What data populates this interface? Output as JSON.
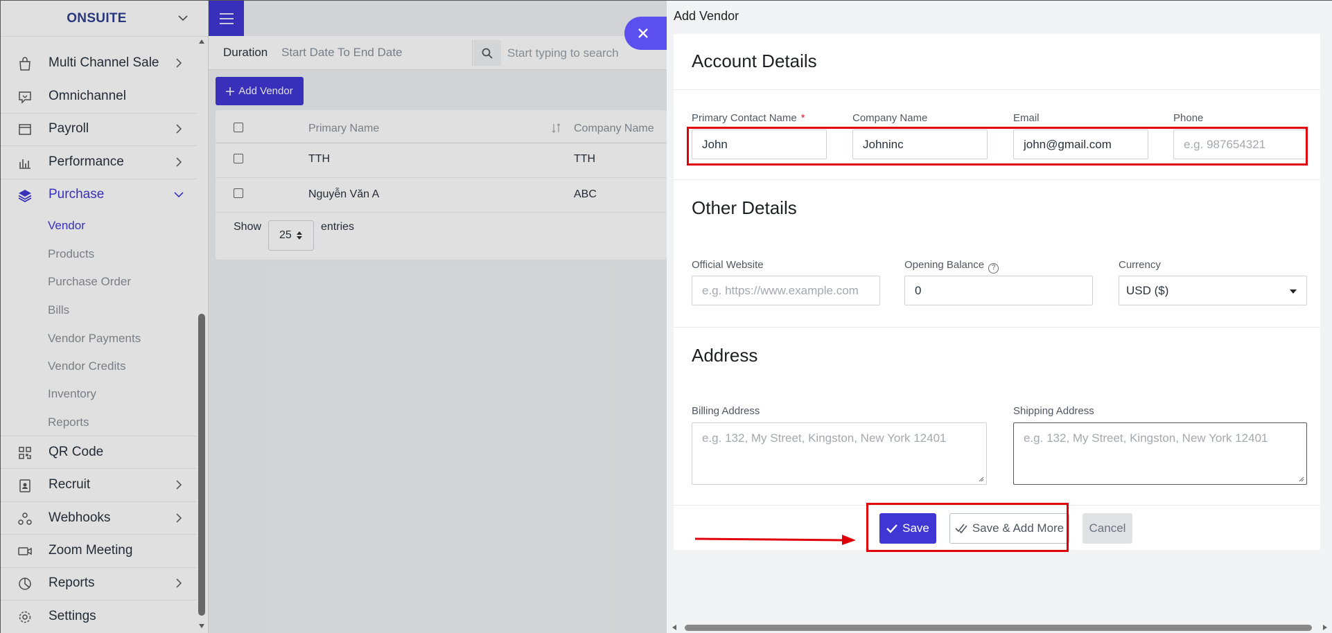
{
  "sidebar": {
    "brand": "ONSUITE",
    "items": [
      {
        "label": "Multi Channel Sale",
        "icon": "bag-icon"
      },
      {
        "label": "Omnichannel",
        "icon": "chat-icon"
      },
      {
        "label": "Payroll",
        "icon": "card-icon"
      },
      {
        "label": "Performance",
        "icon": "bar-chart-icon"
      },
      {
        "label": "Purchase",
        "icon": "layers-icon"
      },
      {
        "label": "QR Code",
        "icon": "qr-code-icon"
      },
      {
        "label": "Recruit",
        "icon": "id-badge-icon"
      },
      {
        "label": "Webhooks",
        "icon": "webhook-icon"
      },
      {
        "label": "Zoom Meeting",
        "icon": "video-icon"
      },
      {
        "label": "Reports",
        "icon": "pie-chart-icon"
      },
      {
        "label": "Settings",
        "icon": "gear-icon"
      }
    ],
    "purchase_sub": [
      "Vendor",
      "Products",
      "Purchase Order",
      "Bills",
      "Vendor Payments",
      "Vendor Credits",
      "Inventory",
      "Reports"
    ]
  },
  "background": {
    "duration_label": "Duration",
    "duration_value": "Start Date To End Date",
    "search_placeholder": "Start typing to search",
    "add_vendor": "Add Vendor",
    "columns": [
      "Primary Name",
      "Company Name"
    ],
    "rows": [
      {
        "primary": "TTH",
        "company": "TTH"
      },
      {
        "primary": "Nguyễn Văn A",
        "company": "ABC"
      }
    ],
    "show_label": "Show",
    "entries_value": "25",
    "entries_label": "entries"
  },
  "panel": {
    "title": "Add Vendor",
    "account_title": "Account Details",
    "primary_contact_label": "Primary Contact Name",
    "required_mark": "*",
    "primary_contact_value": "John",
    "company_label": "Company Name",
    "company_value": "Johninc",
    "email_label": "Email",
    "email_value": "john@gmail.com",
    "phone_label": "Phone",
    "phone_placeholder": "e.g. 987654321",
    "other_title": "Other Details",
    "website_label": "Official Website",
    "website_placeholder": "e.g. https://www.example.com",
    "balance_label": "Opening Balance",
    "balance_value": "0",
    "currency_label": "Currency",
    "currency_value": "USD ($)",
    "address_title": "Address",
    "billing_label": "Billing Address",
    "billing_placeholder": "e.g. 132, My Street, Kingston, New York 12401",
    "shipping_label": "Shipping Address",
    "shipping_placeholder": "e.g. 132, My Street, Kingston, New York 12401",
    "save": "Save",
    "save_more": "Save & Add More",
    "cancel": "Cancel"
  },
  "colors": {
    "accent": "#4036d4",
    "highlight": "#e0000a"
  }
}
